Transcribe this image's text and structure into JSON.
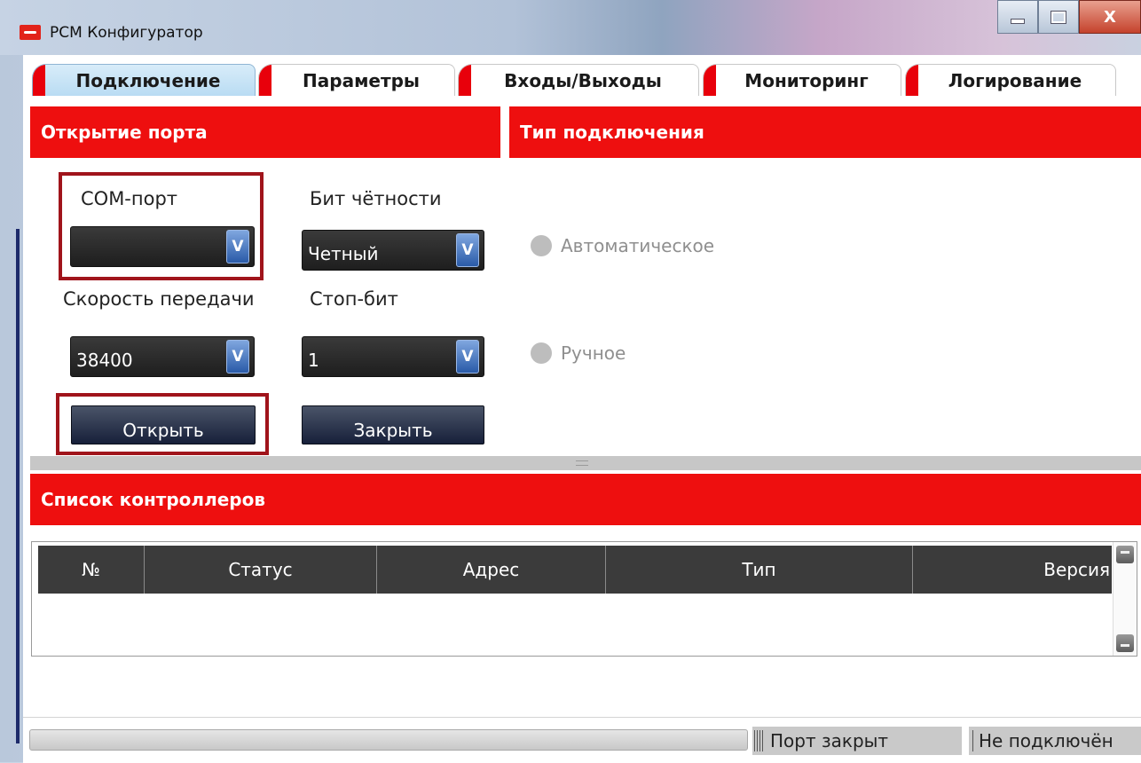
{
  "window": {
    "title": "РСМ Конфигуратор",
    "close_glyph": "X"
  },
  "tabs": [
    {
      "label": "Подключение",
      "active": true
    },
    {
      "label": "Параметры",
      "active": false
    },
    {
      "label": "Входы/Выходы",
      "active": false
    },
    {
      "label": "Мониторинг",
      "active": false
    },
    {
      "label": "Логирование",
      "active": false
    }
  ],
  "open_port": {
    "header": "Открытие порта",
    "com_port_label": "COM-порт",
    "com_port_value": "",
    "parity_label": "Бит чётности",
    "parity_value": "Четный",
    "baud_label": "Скорость передачи",
    "baud_value": "38400",
    "stopbit_label": "Стоп-бит",
    "stopbit_value": "1",
    "open_button": "Открыть",
    "close_button": "Закрыть",
    "dropdown_glyph": "V"
  },
  "connection_type": {
    "header": "Тип подключения",
    "auto_label": "Автоматическое",
    "manual_label": "Ручное"
  },
  "controllers": {
    "header": "Список контроллеров",
    "columns": [
      "№",
      "Статус",
      "Адрес",
      "Тип",
      "Версия"
    ]
  },
  "status": {
    "port": "Порт закрыт",
    "connection": "Не подключён"
  },
  "colors": {
    "accent_red": "#ee0f0f",
    "highlight_border": "#a0141b",
    "combo_dark": "#2a2a2a"
  }
}
